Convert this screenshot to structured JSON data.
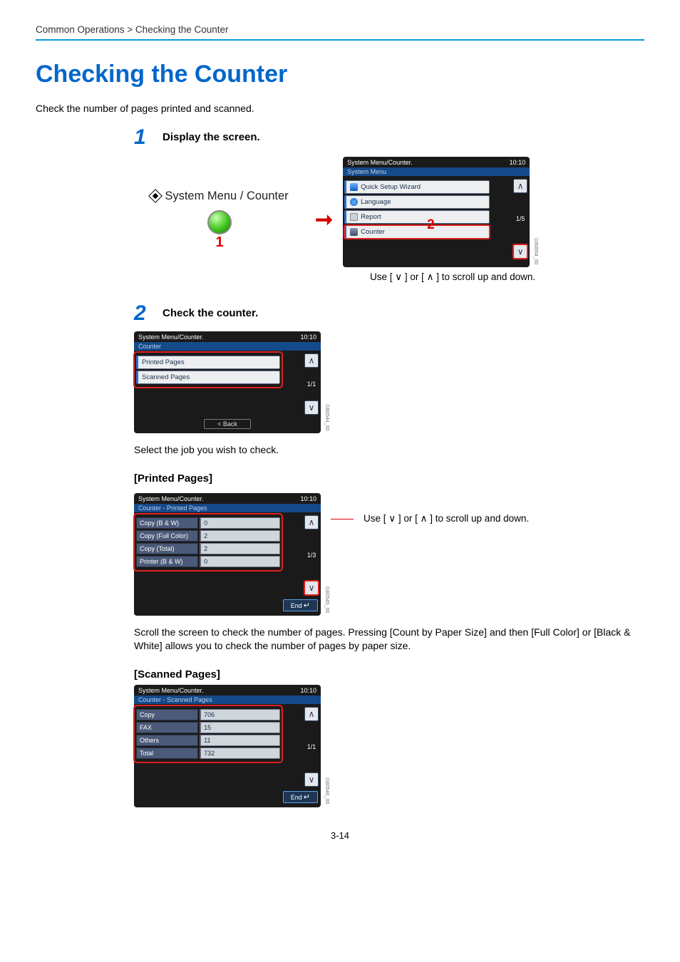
{
  "crumb": "Common Operations > Checking the Counter",
  "title": "Checking the Counter",
  "intro": "Check the number of pages printed and scanned.",
  "step1": {
    "num": "1",
    "heading": "Display the screen.",
    "button_label": "System Menu / Counter",
    "red1": "1",
    "red2": "2"
  },
  "arrow_glyph": "➞",
  "panel_sysmenu": {
    "top_left": "System Menu/Counter.",
    "time": "10:10",
    "sub": "System Menu",
    "items": [
      "Quick Setup Wizard",
      "Language",
      "Report",
      "Counter"
    ],
    "page": "1/5",
    "code": "GB0054_00"
  },
  "scroll_hint": "Use [ ∨ ] or [ ∧ ] to scroll up and down.",
  "step2": {
    "num": "2",
    "heading": "Check the counter."
  },
  "panel_counter": {
    "top_left": "System Menu/Counter.",
    "time": "10:10",
    "sub": "Counter",
    "items": [
      "Printed Pages",
      "Scanned Pages"
    ],
    "page": "1/1",
    "back": "< Back",
    "code": "GB0544_00"
  },
  "select_text": "Select the job you wish to check.",
  "printed_heading": "[Printed Pages]",
  "panel_printed": {
    "top_left": "System Menu/Counter.",
    "time": "10:10",
    "sub": "Counter - Printed Pages",
    "rows": [
      [
        "Copy (B & W)",
        "0"
      ],
      [
        "Copy (Full Color)",
        "2"
      ],
      [
        "Copy (Total)",
        "2"
      ],
      [
        "Printer  (B & W)",
        "0"
      ]
    ],
    "page": "1/3",
    "end": "End",
    "code": "GB0545_00"
  },
  "printed_scroll_hint": "Use [ ∨ ] or [ ∧ ] to scroll up and down.",
  "printed_text": "Scroll the screen to check the number of pages. Pressing [Count by Paper Size] and then [Full Color] or [Black & White] allows you to check the number of pages by paper size.",
  "scanned_heading": "[Scanned Pages]",
  "panel_scanned": {
    "top_left": "System Menu/Counter.",
    "time": "10:10",
    "sub": "Counter - Scanned Pages",
    "rows": [
      [
        "Copy",
        "706"
      ],
      [
        "FAX",
        "15"
      ],
      [
        "Others",
        "11"
      ],
      [
        "Total",
        "732"
      ]
    ],
    "page": "1/1",
    "end": "End",
    "code": "GB0546_00"
  },
  "page_number": "3-14"
}
